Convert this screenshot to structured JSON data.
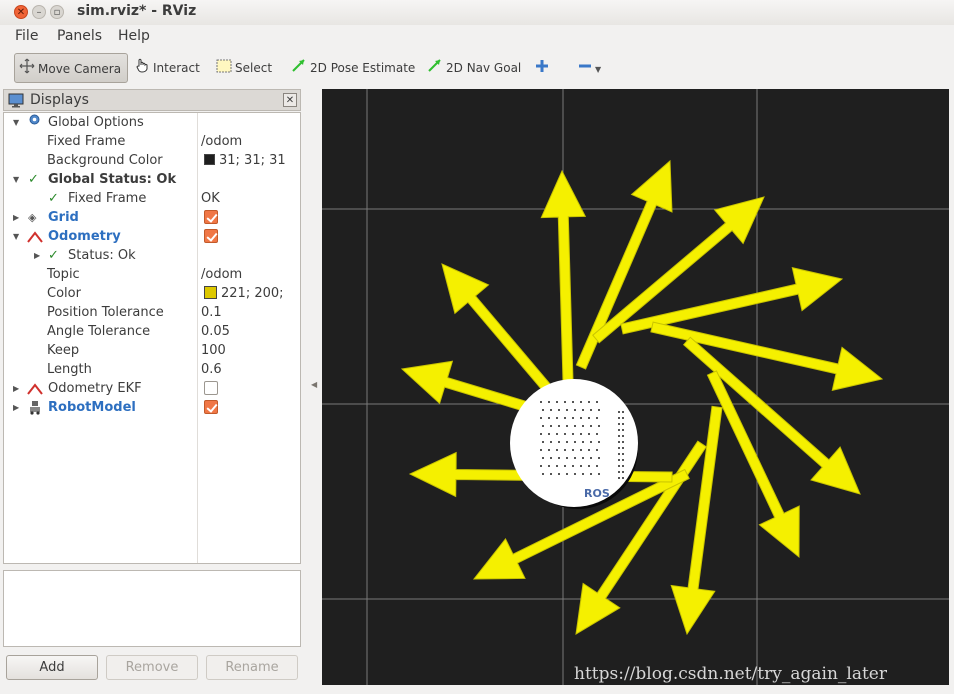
{
  "window": {
    "title": "sim.rviz* - RViz"
  },
  "menu": [
    "File",
    "Panels",
    "Help"
  ],
  "toolbar": {
    "move_camera": "Move Camera",
    "interact": "Interact",
    "select": "Select",
    "pose_estimate": "2D Pose Estimate",
    "nav_goal": "2D Nav Goal"
  },
  "displays": {
    "title": "Displays",
    "rows": [
      {
        "label": "Global Options",
        "value": ""
      },
      {
        "label": "Fixed Frame",
        "value": "/odom"
      },
      {
        "label": "Background Color",
        "value": "31; 31; 31"
      },
      {
        "label": "Global Status: Ok",
        "value": ""
      },
      {
        "label": "Fixed Frame",
        "value": "OK"
      },
      {
        "label": "Grid",
        "value": ""
      },
      {
        "label": "Odometry",
        "value": ""
      },
      {
        "label": "Status: Ok",
        "value": ""
      },
      {
        "label": "Topic",
        "value": "/odom"
      },
      {
        "label": "Color",
        "value": "221; 200;"
      },
      {
        "label": "Position Tolerance",
        "value": "0.1"
      },
      {
        "label": "Angle Tolerance",
        "value": "0.05"
      },
      {
        "label": "Keep",
        "value": "100"
      },
      {
        "label": "Length",
        "value": "0.6"
      },
      {
        "label": "Odometry EKF",
        "value": ""
      },
      {
        "label": "RobotModel",
        "value": ""
      }
    ],
    "checkboxes": {
      "grid": true,
      "odometry": true,
      "odometry_ekf": false,
      "robot_model": true
    },
    "colors": {
      "background": "#1f1f1f",
      "odometry": "#ddc800"
    }
  },
  "buttons": {
    "add": "Add",
    "remove": "Remove",
    "rename": "Rename"
  },
  "view": {
    "robot_label": "ROS",
    "arrow_color": "#f5f000",
    "watermark": "https://blog.csdn.net/try_again_later"
  }
}
